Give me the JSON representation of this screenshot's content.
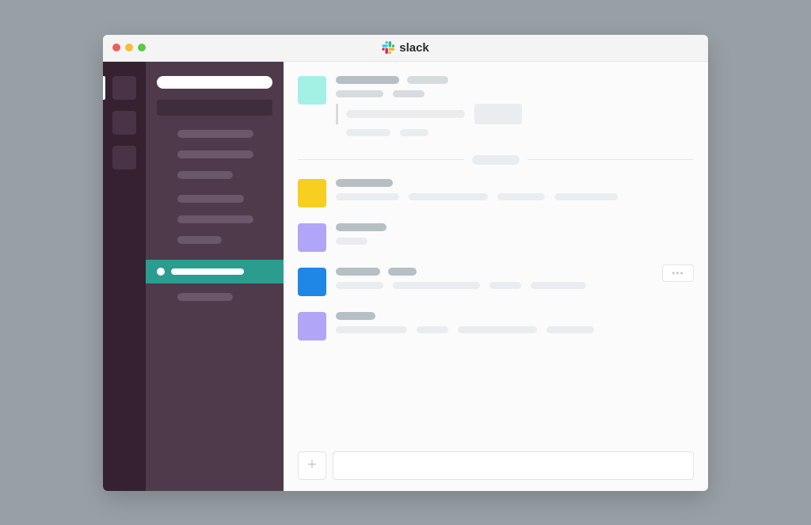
{
  "window": {
    "title": "slack",
    "traffic_lights": {
      "close": "#ec5f57",
      "minimize": "#f6bd3b",
      "maximize": "#5dc942"
    }
  },
  "workspace_rail": {
    "items": [
      {
        "id": "workspace-1",
        "selected": true
      },
      {
        "id": "workspace-2",
        "selected": false
      },
      {
        "id": "workspace-3",
        "selected": false
      }
    ]
  },
  "sidebar": {
    "workspace_name": "",
    "search_placeholder": "",
    "groups": [
      {
        "items": [
          {
            "label": ""
          },
          {
            "label": ""
          },
          {
            "label": ""
          }
        ]
      },
      {
        "items": [
          {
            "label": ""
          },
          {
            "label": ""
          },
          {
            "label": ""
          }
        ]
      }
    ],
    "selected_channel": {
      "label": ""
    },
    "trailing_items": [
      {
        "label": ""
      }
    ]
  },
  "messages": [
    {
      "avatar_color": "#a3f1e4",
      "username": "",
      "text_lines": [
        [
          "",
          ""
        ],
        [
          "",
          "",
          ""
        ]
      ],
      "has_quote": true,
      "has_thread_pill": true,
      "hover_actions": false
    },
    {
      "avatar_color": "#f6cf20",
      "username": "",
      "text_lines": [
        [
          "",
          "",
          "",
          ""
        ]
      ],
      "has_quote": false,
      "hover_actions": false
    },
    {
      "avatar_color": "#b0a5f7",
      "username": "",
      "text_lines": [
        [
          ""
        ]
      ],
      "has_quote": false,
      "hover_actions": false
    },
    {
      "avatar_color": "#1f87e5",
      "username": "",
      "text_lines": [
        [
          "",
          "",
          "",
          ""
        ]
      ],
      "has_quote": false,
      "hover_actions": true
    },
    {
      "avatar_color": "#b0a5f7",
      "username": "",
      "text_lines": [
        [
          "",
          "",
          "",
          ""
        ]
      ],
      "has_quote": false,
      "hover_actions": false
    }
  ],
  "divider_after_index": 0,
  "composer": {
    "attach_icon": "+",
    "input_placeholder": ""
  },
  "colors": {
    "rail_bg": "#362130",
    "sidebar_bg": "#4f3a4b",
    "selected_bg": "#2a9d8f"
  }
}
